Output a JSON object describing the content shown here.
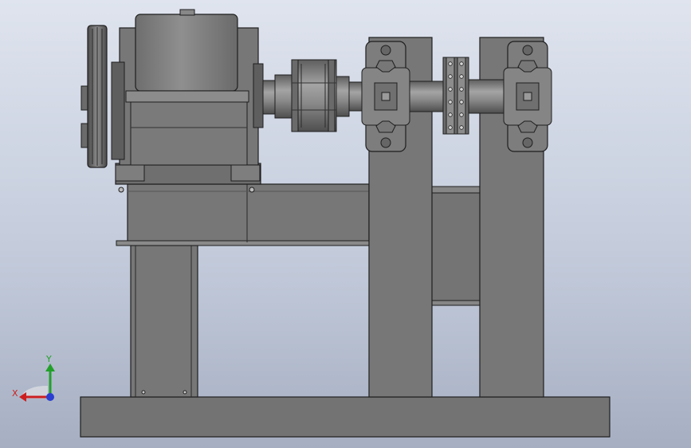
{
  "colors": {
    "background_top": "#dfe4ee",
    "background_bottom": "#a6afc2",
    "steel": "#767676",
    "steel_light": "#8e8e8e",
    "steel_dark": "#5a5a5a",
    "edge": "#202020",
    "axis_x": "#cc1f1f",
    "axis_y": "#22a02a",
    "axis_z": "#2a3fd0"
  },
  "triad": {
    "x_label": "X",
    "y_label": "Y",
    "icon": "triad-axes-icon"
  }
}
